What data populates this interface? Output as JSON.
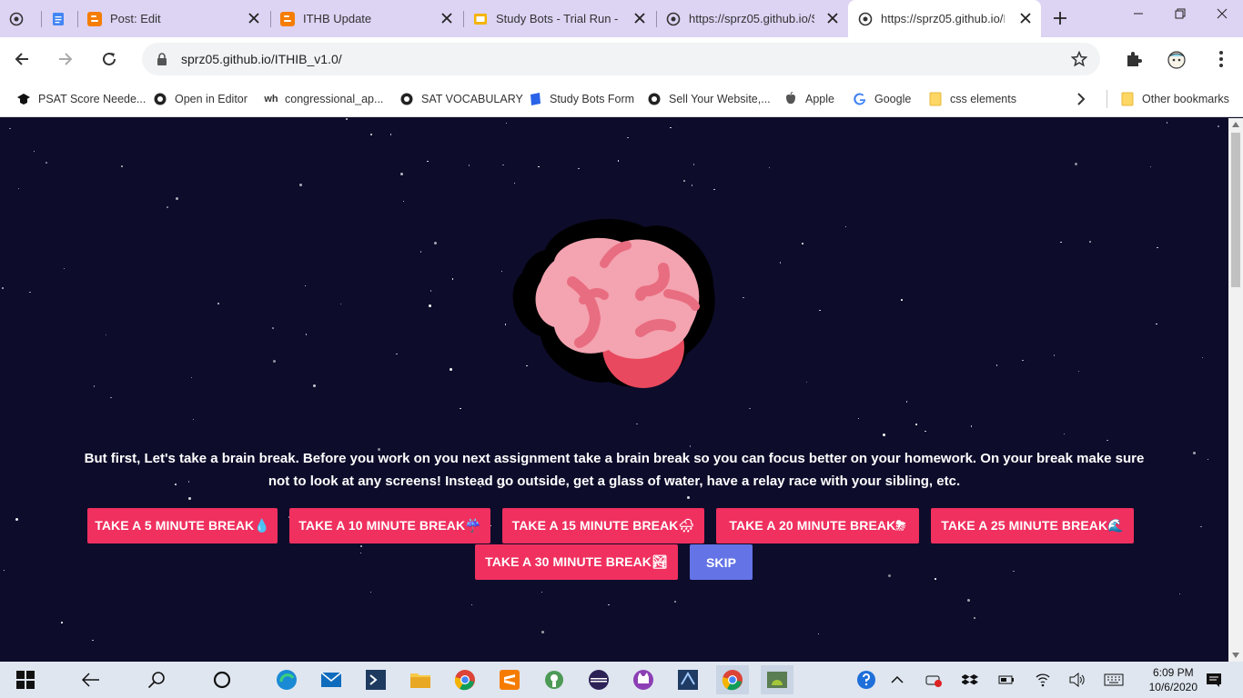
{
  "browser": {
    "tabs": [
      {
        "title": "",
        "icon": "globe-icon"
      },
      {
        "title": "",
        "icon": "docs-icon"
      },
      {
        "title": "Post: Edit",
        "icon": "blogger-icon"
      },
      {
        "title": "ITHB Update",
        "icon": "blogger-icon"
      },
      {
        "title": "Study Bots - Trial Run - G",
        "icon": "slides-icon"
      },
      {
        "title": "https://sprz05.github.io/S",
        "icon": "globe-icon"
      },
      {
        "title": "https://sprz05.github.io/I",
        "icon": "globe-icon"
      }
    ],
    "url": "sprz05.github.io/ITHIB_v1.0/",
    "bookmarks": [
      {
        "label": "PSAT Score Neede...",
        "icon": "cap-icon"
      },
      {
        "label": "Open in Editor",
        "icon": "github-icon"
      },
      {
        "label": "congressional_ap...",
        "icon": "wh-icon"
      },
      {
        "label": "SAT VOCABULARY",
        "icon": "github-icon"
      },
      {
        "label": "Study Bots Form",
        "icon": "form-icon"
      },
      {
        "label": "Sell Your Website,...",
        "icon": "github-icon"
      },
      {
        "label": "Apple",
        "icon": "apple-icon"
      },
      {
        "label": "Google",
        "icon": "google-icon"
      },
      {
        "label": "css elements",
        "icon": "folder-icon"
      },
      {
        "label": "Other bookmarks",
        "icon": "folder-icon"
      }
    ],
    "wh_text": "wh"
  },
  "page": {
    "message": "But first, Let's take a brain break. Before you work on you next assignment take a brain break so you can focus better on your homework. On your break make sure not to look at any screens! Instead go outside, get a glass of water, have a relay race with your sibling, etc.",
    "buttons": [
      {
        "label": "TAKE A 5 MINUTE BREAK💧"
      },
      {
        "label": "TAKE A 10 MINUTE BREAK☔"
      },
      {
        "label": "TAKE A 15 MINUTE BREAK🌧"
      },
      {
        "label": "TAKE A 20 MINUTE BREAK⛈"
      },
      {
        "label": "TAKE A 25 MINUTE BREAK🌊"
      },
      {
        "label": "TAKE A 30 MINUTE BREAK🏞"
      }
    ],
    "skip_label": "SKIP",
    "colors": {
      "background": "#0d0c2b",
      "button": "#f0305f",
      "skip": "#6473e6"
    }
  },
  "taskbar": {
    "time": "6:09 PM",
    "date": "10/6/2020"
  }
}
